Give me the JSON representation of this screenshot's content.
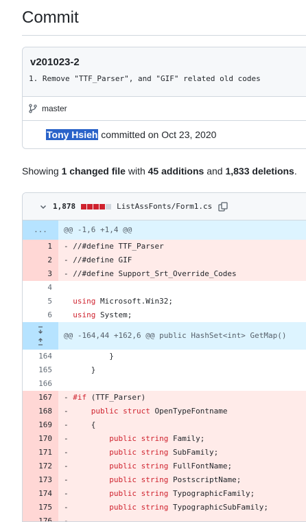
{
  "page": {
    "title": "Commit"
  },
  "commit": {
    "title": "v201023-2",
    "description": "1. Remove \"TTF_Parser\", and \"GIF\" related old codes",
    "branch": "master",
    "author": "Tony Hsieh",
    "committed_text": " committed on Oct 23, 2020"
  },
  "summary": {
    "prefix": "Showing ",
    "changed": "1 changed file",
    "with": " with ",
    "additions": "45 additions",
    "and": " and ",
    "deletions": "1,833 deletions",
    "suffix": "."
  },
  "file": {
    "change_count": "1,878",
    "name": "ListAssFonts/Form1.cs",
    "colors": {
      "del": "#cf222e",
      "add": "#2da44e",
      "neutral": "#d0d7de"
    }
  },
  "diff": {
    "hunk1": {
      "ln": "...",
      "text": "@@ -1,6 +1,4 @@"
    },
    "lines_a": [
      {
        "type": "del",
        "ln": "1",
        "sign": "-",
        "text": " //#define TTF_Parser"
      },
      {
        "type": "del",
        "ln": "2",
        "sign": "-",
        "text": " //#define GIF"
      },
      {
        "type": "del",
        "ln": "3",
        "sign": "-",
        "text": " //#define Support_Srt_Override_Codes"
      },
      {
        "type": "ctx",
        "ln": "4",
        "sign": " ",
        "text": ""
      },
      {
        "type": "ctx",
        "ln": "5",
        "sign": " ",
        "text": " using Microsoft.Win32;"
      },
      {
        "type": "ctx",
        "ln": "6",
        "sign": " ",
        "text": " using System;"
      }
    ],
    "hunk2": {
      "text": "@@ -164,44 +162,6 @@ public HashSet<int> GetMap()"
    },
    "lines_b": [
      {
        "type": "ctx",
        "ln": "164",
        "sign": " ",
        "text": "         }"
      },
      {
        "type": "ctx",
        "ln": "165",
        "sign": " ",
        "text": "     }"
      },
      {
        "type": "ctx",
        "ln": "166",
        "sign": " ",
        "text": ""
      },
      {
        "type": "del",
        "ln": "167",
        "sign": "-",
        "text": " #if (TTF_Parser)"
      },
      {
        "type": "del",
        "ln": "168",
        "sign": "-",
        "text": "     public struct OpenTypeFontname"
      },
      {
        "type": "del",
        "ln": "169",
        "sign": "-",
        "text": "     {"
      },
      {
        "type": "del",
        "ln": "170",
        "sign": "-",
        "text": "         public string Family;"
      },
      {
        "type": "del",
        "ln": "171",
        "sign": "-",
        "text": "         public string SubFamily;"
      },
      {
        "type": "del",
        "ln": "172",
        "sign": "-",
        "text": "         public string FullFontName;"
      },
      {
        "type": "del",
        "ln": "173",
        "sign": "-",
        "text": "         public string PostscriptName;"
      },
      {
        "type": "del",
        "ln": "174",
        "sign": "-",
        "text": "         public string TypographicFamily;"
      },
      {
        "type": "del",
        "ln": "175",
        "sign": "-",
        "text": "         public string TypographicSubFamily;"
      },
      {
        "type": "del",
        "ln": "176",
        "sign": "-",
        "text": ""
      }
    ]
  }
}
